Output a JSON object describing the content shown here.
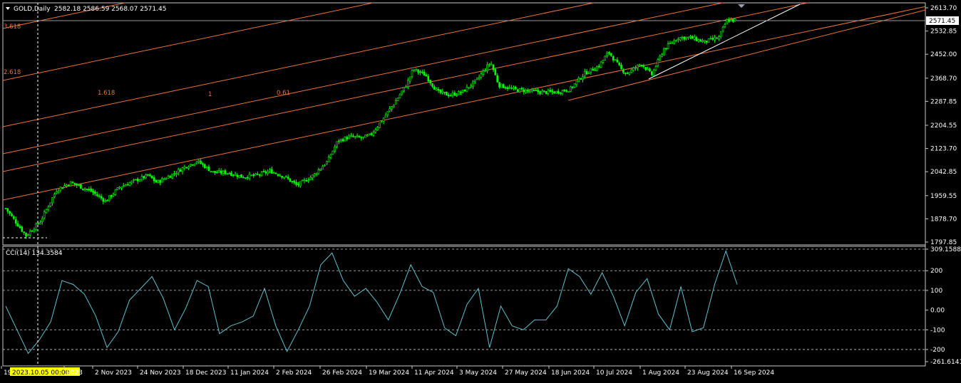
{
  "main_chart": {
    "title_prefix": "GOLD,Daily",
    "ohlc": "2582.18 2586.59 2568.07 2571.45",
    "current_price": "2571.45"
  },
  "indicator": {
    "label": "CCI(14) 134.3584"
  },
  "crosshair_date": "2023.10.05 00:00",
  "colors": {
    "background": "#000000",
    "candle": "#00ff00",
    "fib_lines": "#e8743b",
    "trend_line": "#ffffff",
    "cci_line": "#5fc0d0",
    "grid": "#c8c8c8"
  },
  "chart_data": [
    {
      "type": "candlestick",
      "symbol": "GOLD",
      "timeframe": "Daily",
      "y_ticks": [
        "2613.70",
        "2532.85",
        "2452.00",
        "2368.70",
        "2287.85",
        "2204.55",
        "2123.70",
        "2042.85",
        "1959.55",
        "1878.70",
        "1797.85"
      ],
      "ylim": [
        1797.85,
        2613.7
      ],
      "x_ticks": [
        "19",
        "2023.10.05 00:00",
        "2023",
        "2 Nov 2023",
        "24 Nov 2023",
        "18 Dec 2023",
        "11 Jan 2024",
        "2 Feb 2024",
        "26 Feb 2024",
        "19 Mar 2024",
        "11 Apr 2024",
        "3 May 2024",
        "27 May 2024",
        "18 Jun 2024",
        "10 Jul 2024",
        "1 Aug 2024",
        "23 Aug 2024",
        "16 Sep 2024"
      ],
      "fib_levels": [
        "3.618",
        "2.618",
        "1.618",
        "1",
        "0.61"
      ],
      "close_series": [
        [
          "2023-09-25",
          1915
        ],
        [
          "2023-10-05",
          1820
        ],
        [
          "2023-10-12",
          1870
        ],
        [
          "2023-10-20",
          1980
        ],
        [
          "2023-10-27",
          2005
        ],
        [
          "2023-11-06",
          1975
        ],
        [
          "2023-11-13",
          1940
        ],
        [
          "2023-11-20",
          1990
        ],
        [
          "2023-11-27",
          2010
        ],
        [
          "2023-12-04",
          2030
        ],
        [
          "2023-12-08",
          2005
        ],
        [
          "2023-12-15",
          2030
        ],
        [
          "2023-12-22",
          2060
        ],
        [
          "2023-12-28",
          2080
        ],
        [
          "2024-01-05",
          2040
        ],
        [
          "2024-01-12",
          2040
        ],
        [
          "2024-01-19",
          2025
        ],
        [
          "2024-01-26",
          2030
        ],
        [
          "2024-02-02",
          2045
        ],
        [
          "2024-02-09",
          2025
        ],
        [
          "2024-02-15",
          1995
        ],
        [
          "2024-02-23",
          2030
        ],
        [
          "2024-03-01",
          2080
        ],
        [
          "2024-03-06",
          2150
        ],
        [
          "2024-03-12",
          2165
        ],
        [
          "2024-03-18",
          2160
        ],
        [
          "2024-03-22",
          2170
        ],
        [
          "2024-03-28",
          2225
        ],
        [
          "2024-04-04",
          2295
        ],
        [
          "2024-04-09",
          2350
        ],
        [
          "2024-04-12",
          2400
        ],
        [
          "2024-04-18",
          2380
        ],
        [
          "2024-04-24",
          2320
        ],
        [
          "2024-04-30",
          2310
        ],
        [
          "2024-05-06",
          2320
        ],
        [
          "2024-05-13",
          2360
        ],
        [
          "2024-05-20",
          2425
        ],
        [
          "2024-05-24",
          2345
        ],
        [
          "2024-05-31",
          2330
        ],
        [
          "2024-06-07",
          2325
        ],
        [
          "2024-06-14",
          2320
        ],
        [
          "2024-06-21",
          2320
        ],
        [
          "2024-06-28",
          2330
        ],
        [
          "2024-07-05",
          2385
        ],
        [
          "2024-07-12",
          2410
        ],
        [
          "2024-07-17",
          2460
        ],
        [
          "2024-07-23",
          2400
        ],
        [
          "2024-07-26",
          2385
        ],
        [
          "2024-08-02",
          2420
        ],
        [
          "2024-08-07",
          2380
        ],
        [
          "2024-08-13",
          2470
        ],
        [
          "2024-08-20",
          2510
        ],
        [
          "2024-08-26",
          2510
        ],
        [
          "2024-09-02",
          2495
        ],
        [
          "2024-09-09",
          2510
        ],
        [
          "2024-09-13",
          2570
        ],
        [
          "2024-09-18",
          2571
        ]
      ]
    },
    {
      "type": "line",
      "name": "CCI(14)",
      "y_ticks": [
        "309.1588",
        "200",
        "100",
        "0.00",
        "-100",
        "-200",
        "-261.6141"
      ],
      "ylim": [
        -261.6141,
        309.1588
      ],
      "values": [
        20,
        -100,
        -220,
        -150,
        -60,
        150,
        130,
        80,
        -30,
        -190,
        -110,
        50,
        110,
        170,
        60,
        -100,
        10,
        150,
        120,
        -120,
        -80,
        -60,
        -30,
        110,
        -80,
        -210,
        -100,
        20,
        230,
        290,
        150,
        70,
        110,
        40,
        -50,
        80,
        230,
        120,
        90,
        -90,
        -130,
        30,
        110,
        -190,
        20,
        -80,
        -100,
        -50,
        -50,
        20,
        210,
        170,
        80,
        190,
        70,
        -80,
        90,
        160,
        -20,
        -100,
        120,
        -110,
        -90,
        130,
        300,
        130
      ]
    }
  ]
}
